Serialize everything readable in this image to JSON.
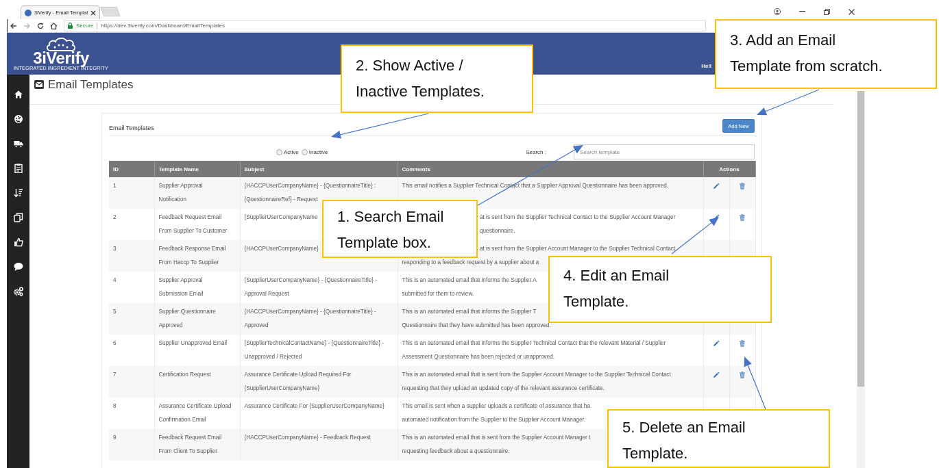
{
  "browser": {
    "tab_title": "3iVerify - Email Templat",
    "security": "Secure",
    "url": "https://dev.3iverify.com/Dashboard/EmailTemplates"
  },
  "header": {
    "logo": "3iVerify",
    "tagline": "INTEGRATED INGREDIENT INTEGRITY",
    "greeting": "Hell"
  },
  "page_title": "Email Templates",
  "panel": {
    "title": "Email Templates",
    "add_button": "Add New",
    "filters": [
      {
        "label": "Active",
        "checked": false
      },
      {
        "label": "Inactive",
        "checked": false
      }
    ],
    "search": {
      "label": "Search :",
      "placeholder": "Search template"
    }
  },
  "table": {
    "columns": [
      "ID",
      "Template Name",
      "Subject",
      "Comments",
      "Actions"
    ],
    "rows": [
      {
        "id": "1",
        "name": [
          "Supplier Approval",
          "Notification"
        ],
        "subject": [
          "{HACCPUserCompanyName} - {QuestionnaireTitle} :",
          "{QuestionnaireRef} - Request"
        ],
        "comments": [
          "This email notifies a Supplier Technical Contact that a Supplier Approval Questionnaire has been approved."
        ],
        "actions": [
          {
            "kind": "edit"
          },
          {
            "kind": "delete"
          }
        ]
      },
      {
        "id": "2",
        "name": [
          "Feedback Request Email",
          "From Supplier To Customer"
        ],
        "subject": [
          "{SupplierUserCompanyName"
        ],
        "comments": [
          "at is sent from the Supplier Technical Contact to the Supplier Account Manager",
          "questionnaire."
        ],
        "actions": [
          {
            "kind": "edit"
          },
          {
            "kind": "delete"
          }
        ]
      },
      {
        "id": "3",
        "name": [
          "Feedback Response Email",
          "From Haccp To Supplier"
        ],
        "subject": [
          "{HACCPUserCompanyName}"
        ],
        "comments": [
          "at is sent from the Supplier Account Manager to the Supplier Technical Contact",
          "responding to a feedback request by a supplier about a"
        ]
      },
      {
        "id": "4",
        "name": [
          "Supplier Approval",
          "Submission Email"
        ],
        "subject": [
          "{SupplierUserCompanyName} - {QuestionnaireTitle} -",
          "Approval Request"
        ],
        "comments": [
          "This is an automated email that informs the Supplier A",
          "submitted for them to review."
        ]
      },
      {
        "id": "5",
        "name": [
          "Supplier Questionnaire",
          "Approved"
        ],
        "subject": [
          "{HACCPUserCompanyName} - {QuestionnaireTitle} -",
          "Approved"
        ],
        "comments": [
          "This is an automated email that informs the Supplier T",
          "Questionnaire that they have submitted has been approved."
        ]
      },
      {
        "id": "6",
        "name": [
          "Supplier Unapproved Email"
        ],
        "subject": [
          "{SupplierTechnicalContactName} - {QuestionnaireTitle} -",
          "Unapproved / Rejected"
        ],
        "comments": [
          "This is an automated email that informs the Supplier Technical Contact that the relevant Material / Supplier",
          "Assessment Questionnaire has been rejected or unapproved."
        ],
        "actions": [
          {
            "kind": "edit"
          },
          {
            "kind": "delete"
          }
        ]
      },
      {
        "id": "7",
        "name": [
          "Certification Request"
        ],
        "subject": [
          "Assurance Certificate Upload Required For",
          "{SupplierUserCompanyName}"
        ],
        "comments": [
          "This is an automated email that is sent from the Supplier Account Manager to the Supplier Technical Contact",
          "requesting that they upload an updated copy of the relevant assurance certificate."
        ],
        "actions": [
          {
            "kind": "edit"
          },
          {
            "kind": "delete"
          }
        ]
      },
      {
        "id": "8",
        "name": [
          "Assurance Certificate Upload",
          "Confirmation Email"
        ],
        "subject": [
          "Assurance Certificate For {SupplierUserCompanyName}"
        ],
        "comments": [
          "This email is sent when a supplier uploads a certificate of assurance that ha",
          "automated notification from the Supplier to the Supplier Account Manager."
        ]
      },
      {
        "id": "9",
        "name": [
          "Feedback Request Email",
          "From Client To Supplier"
        ],
        "subject": [
          "{HACCPUserCompanyName} - Feedback Request"
        ],
        "comments": [
          "This is an automated email that is sent from the Supplier Account Manager t",
          "requesting feedback about a questionnaire."
        ]
      }
    ]
  },
  "callouts": [
    "2. Show Active / Inactive Templates.",
    "3. Add an Email Template from scratch.",
    "1. Search Email Template box.",
    "4. Edit an Email Template.",
    "5. Delete an Email Template."
  ]
}
